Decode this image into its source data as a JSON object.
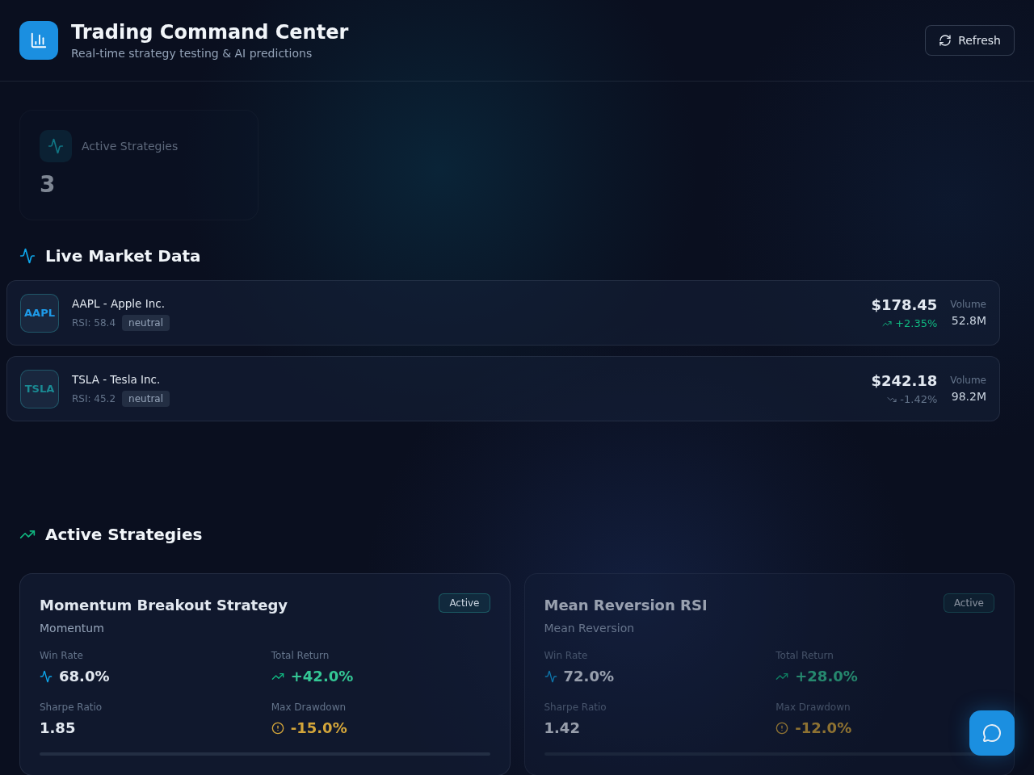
{
  "header": {
    "title": "Trading Command Center",
    "subtitle": "Real-time strategy testing & AI predictions",
    "refresh_button": "Refresh"
  },
  "stats": [
    {
      "label": "Active Strategies",
      "value": "3"
    }
  ],
  "market": {
    "title": "Live Market Data",
    "rows": [
      {
        "ticker": "AAPL",
        "color": "#1e9ae8",
        "name": "AAPL - Apple Inc.",
        "rsi": "RSI: 58.4",
        "signal": "neutral",
        "price": "$178.45",
        "kind": "gain",
        "change": "+2.35%",
        "volume_label": "Volume",
        "volume": "52.8M"
      },
      {
        "ticker": "TSLA",
        "color": "#1a8a93",
        "name": "TSLA - Tesla Inc.",
        "rsi": "RSI: 45.2",
        "signal": "neutral",
        "price": "$242.18",
        "kind": "loss",
        "change": "-1.42%",
        "volume_label": "Volume",
        "volume": "98.2M"
      }
    ]
  },
  "strategies": {
    "title": "Active Strategies",
    "cards": [
      {
        "name": "Momentum Breakout Strategy",
        "type": "Momentum",
        "status": "Active",
        "metrics": [
          {
            "kind": "win_rate",
            "label": "Win Rate",
            "value": "68.0%"
          },
          {
            "kind": "return",
            "label": "Total Return",
            "value": "+42.0%"
          },
          {
            "kind": "plain",
            "label": "Sharpe Ratio",
            "value": "1.85"
          },
          {
            "kind": "drawdown",
            "label": "Max Drawdown",
            "value": "-15.0%"
          }
        ]
      },
      {
        "name": "Mean Reversion RSI",
        "type": "Mean Reversion",
        "status": "Active",
        "metrics": [
          {
            "kind": "win_rate",
            "label": "Win Rate",
            "value": "72.0%"
          },
          {
            "kind": "return",
            "label": "Total Return",
            "value": "+28.0%"
          },
          {
            "kind": "plain",
            "label": "Sharpe Ratio",
            "value": "1.42"
          },
          {
            "kind": "drawdown",
            "label": "Max Drawdown",
            "value": "-12.0%"
          }
        ]
      }
    ]
  }
}
